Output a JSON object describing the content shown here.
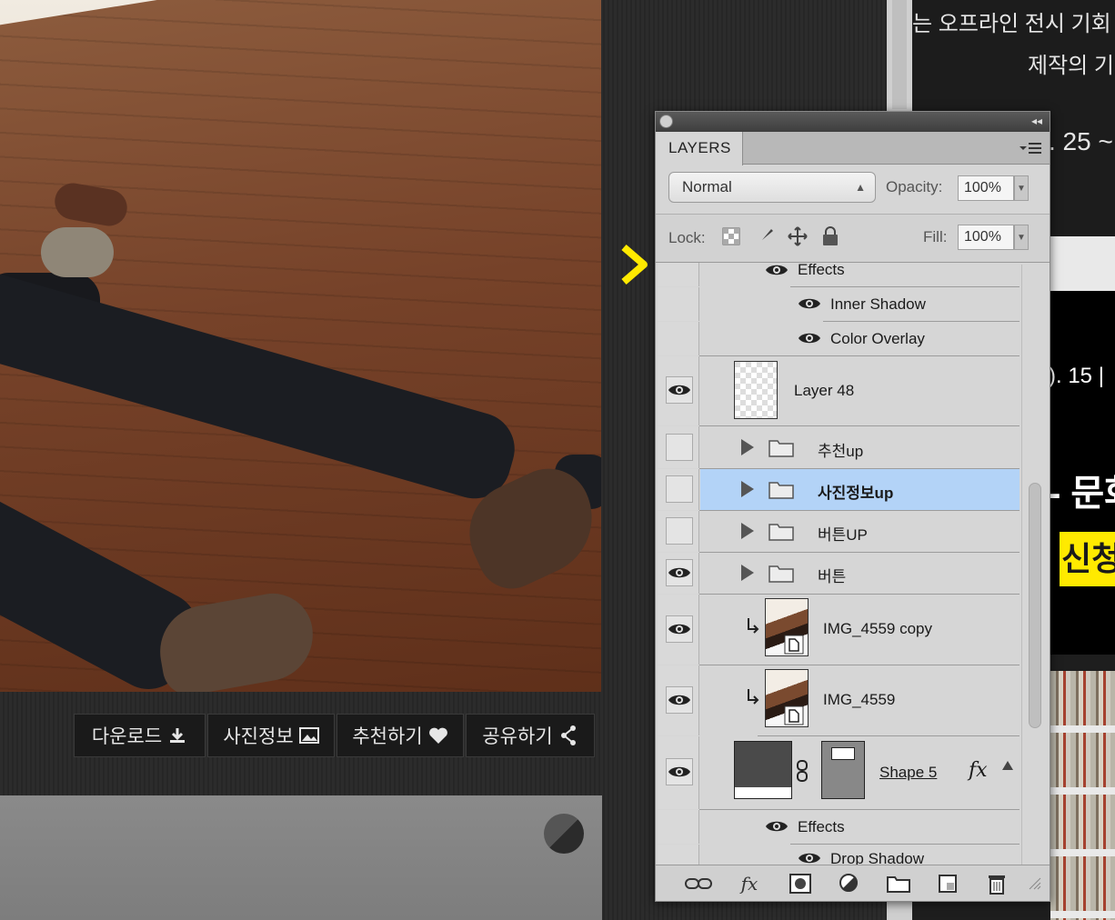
{
  "photo_actions": [
    {
      "label": "다운로드",
      "icon": "download-icon"
    },
    {
      "label": "사진정보",
      "icon": "image-icon"
    },
    {
      "label": "추천하기",
      "icon": "heart-icon"
    },
    {
      "label": "공유하기",
      "icon": "share-icon"
    }
  ],
  "right_page": {
    "line1": "는 오프라인 전시 기회",
    "line2": "제작의 기",
    "line3": ". 25 ~",
    "date": "). 15  |",
    "headline": "- 문화",
    "apply_button": "신청"
  },
  "layers_panel": {
    "tab_label": "LAYERS",
    "blend_mode": "Normal",
    "opacity_label": "Opacity:",
    "opacity_value": "100%",
    "lock_label": "Lock:",
    "fill_label": "Fill:",
    "fill_value": "100%",
    "rows": [
      {
        "name": "Effects",
        "kind": "effects-header",
        "visible": true
      },
      {
        "name": "Inner Shadow",
        "kind": "effect",
        "visible": true
      },
      {
        "name": "Color Overlay",
        "kind": "effect",
        "visible": true
      },
      {
        "name": "Layer 48",
        "kind": "layer",
        "visible": true
      },
      {
        "name": "추천up",
        "kind": "group",
        "visible": false
      },
      {
        "name": "사진정보up",
        "kind": "group",
        "visible": false,
        "selected": true
      },
      {
        "name": "버튼UP",
        "kind": "group",
        "visible": false
      },
      {
        "name": "버튼",
        "kind": "group",
        "visible": true
      },
      {
        "name": "IMG_4559 copy",
        "kind": "smart-object",
        "visible": true,
        "clipped": true
      },
      {
        "name": "IMG_4559",
        "kind": "smart-object",
        "visible": true,
        "clipped": true
      },
      {
        "name": "Shape 5",
        "kind": "shape",
        "visible": true,
        "has_fx": true
      },
      {
        "name": "Effects",
        "kind": "effects-header",
        "visible": true
      },
      {
        "name": "Drop Shadow",
        "kind": "effect",
        "visible": true
      }
    ],
    "fx_label": "fx",
    "bottom_icons": [
      "link-icon",
      "fx-icon",
      "mask-icon",
      "adjustment-icon",
      "folder-icon",
      "new-layer-icon",
      "trash-icon"
    ]
  },
  "colors": {
    "accent_yellow": "#ffea00",
    "selection": "#b3d3f7"
  }
}
